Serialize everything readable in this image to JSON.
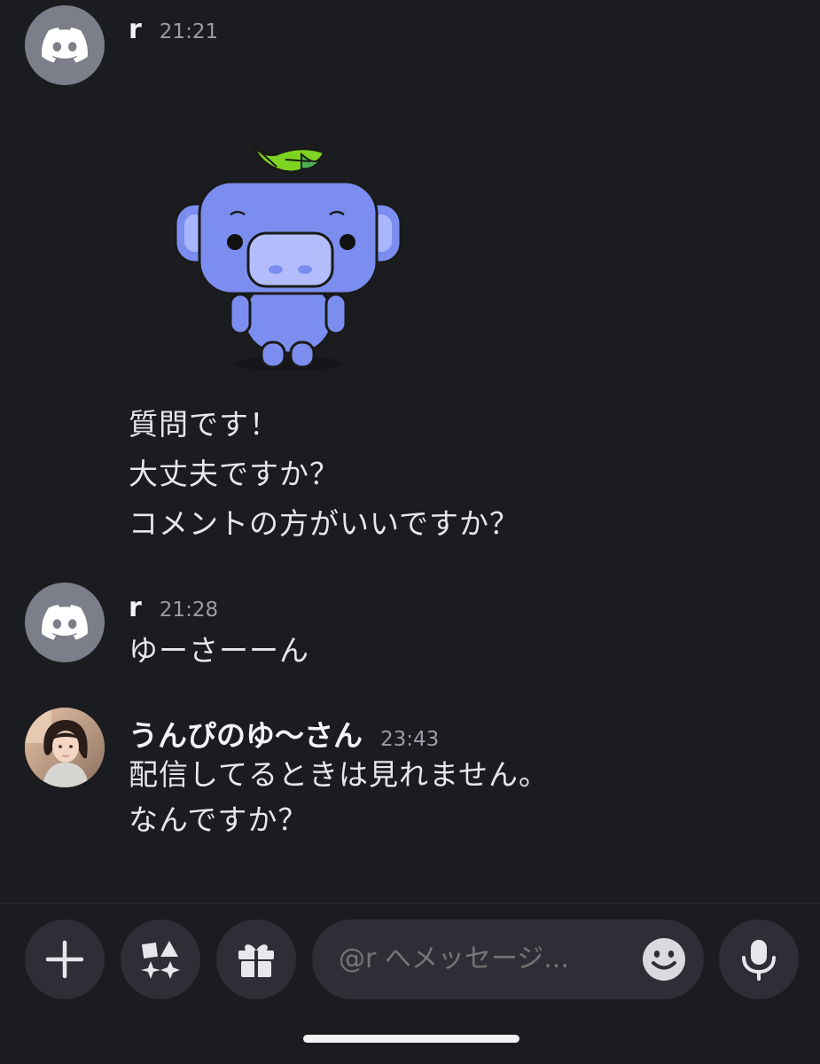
{
  "messages": [
    {
      "username": "r",
      "time": "21:21",
      "sticker": "wumpus-with-leaf",
      "lines": [
        "質問です！",
        "大丈夫ですか？",
        "コメントの方がいいですか？"
      ]
    },
    {
      "username": "r",
      "time": "21:28",
      "lines": [
        "ゆーさーーん"
      ]
    },
    {
      "username": "うんぴのゆ〜さん",
      "time": "23:43",
      "lines": [
        "配信してるときは見れません。",
        "なんですか？"
      ]
    }
  ],
  "composer": {
    "placeholder": "@r へメッセージ..."
  },
  "icons": {
    "avatar_default": "discord-logo-icon",
    "add": "plus-icon",
    "apps": "apps-icon",
    "gift": "gift-icon",
    "emoji": "emoji-icon",
    "voice": "microphone-icon"
  },
  "colors": {
    "background": "#1b1c20",
    "button": "#2e2f36",
    "avatar_default": "#7c7f89",
    "wumpus": "#7b8ef0"
  }
}
